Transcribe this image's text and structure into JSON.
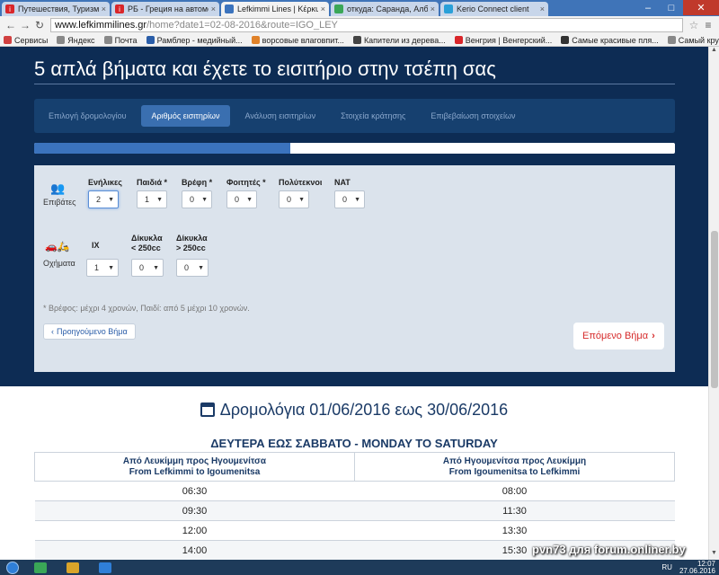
{
  "browser": {
    "tabs": [
      {
        "label": "Путешествия, Туризм и ...",
        "fav_color": "#d9262a",
        "fav_glyph": "i",
        "active": false
      },
      {
        "label": "РБ - Греция на автомоби...",
        "fav_color": "#d9262a",
        "fav_glyph": "i",
        "active": false
      },
      {
        "label": "Lefkimmi Lines | Κέρκυρα ...",
        "fav_color": "#3b73bd",
        "fav_glyph": "",
        "active": true
      },
      {
        "label": "откуда: Саранда, Албани...",
        "fav_color": "#3aa757",
        "fav_glyph": "",
        "active": false
      },
      {
        "label": "Kerio Connect client",
        "fav_color": "#2aa0d8",
        "fav_glyph": "",
        "active": false
      }
    ],
    "url_host": "www.lefkimmilines.gr",
    "url_path": "/home?date1=02-08-2016&route=IGO_LEY",
    "bookmarks": [
      {
        "label": "Сервисы",
        "color": "#d04040"
      },
      {
        "label": "Яндекс",
        "color": "#888888"
      },
      {
        "label": "Почта",
        "color": "#888888"
      },
      {
        "label": "Рамблер - медийный...",
        "color": "#2a5da8"
      },
      {
        "label": "ворсовые влаговпит...",
        "color": "#e0822a"
      },
      {
        "label": "Капители из дерева...",
        "color": "#444444"
      },
      {
        "label": "Венгрия | Венгерский...",
        "color": "#d9262a"
      },
      {
        "label": "Самые красивые пля...",
        "color": "#333333"
      },
      {
        "label": "Самый крупный торг...",
        "color": "#888888"
      }
    ],
    "bookmarks_more": "»"
  },
  "hero": {
    "title": "5 απλά βήματα και έχετε το εισιτήριο στην τσέπη σας",
    "steps": [
      {
        "label": "Επιλογή δρομολογίου",
        "active": false
      },
      {
        "label": "Αριθμός εισιτηρίων",
        "active": true
      },
      {
        "label": "Ανάλυση εισιτηρίων",
        "active": false
      },
      {
        "label": "Στοιχεία κράτησης",
        "active": false
      },
      {
        "label": "Επιβεβαίωση στοιχείων",
        "active": false
      }
    ],
    "progress_fraction": 0.4
  },
  "form": {
    "passengers_label": "Επιβάτες",
    "passengers": [
      {
        "label": "Ενήλικες",
        "value": "2"
      },
      {
        "label": "Παιδιά *",
        "value": "1"
      },
      {
        "label": "Βρέφη *",
        "value": "0"
      },
      {
        "label": "Φοιτητές *",
        "value": "0"
      },
      {
        "label": "Πολύτεκνοι",
        "value": "0"
      },
      {
        "label": "ΝΑΤ",
        "value": "0"
      }
    ],
    "vehicles_label": "Οχήματα",
    "vehicles": [
      {
        "label": "ΙΧ",
        "value": "1"
      },
      {
        "label": "Δίκυκλα\n< 250cc",
        "value": "0"
      },
      {
        "label": "Δίκυκλα\n> 250cc",
        "value": "0"
      }
    ],
    "note": "* Βρέφος: μέχρι 4 χρονών, Παιδί: από 5 μέχρι 10 χρονών.",
    "prev_button": "Προηγούμενο Βήμα",
    "next_button": "Επόμενο Βήμα"
  },
  "schedule": {
    "title": "Δρομολόγια 01/06/2016 εως 30/06/2016",
    "subtitle": "ΔΕΥΤΕΡΑ ΕΩΣ ΣΑΒΒΑΤΟ - MONDAY TO SATURDAY",
    "headers": [
      [
        "Από Λευκίμμη προς Ηγουμενίτσα",
        "From Lefkimmi to Igoumenitsa"
      ],
      [
        "Από Ηγουμενίτσα προς Λευκίμμη",
        "From Igoumenitsa to Lefkimmi"
      ]
    ],
    "rows": [
      [
        "06:30",
        "08:00"
      ],
      [
        "09:30",
        "11:30"
      ],
      [
        "12:00",
        "13:30"
      ],
      [
        "14:00",
        "15:30"
      ]
    ]
  },
  "taskbar": {
    "lang": "RU",
    "time": "12:07",
    "date": "27.06.2016",
    "apps": [
      "#3aa757",
      "#d9a42a",
      "#2f7fd8"
    ]
  },
  "watermark": "pvn73 для forum.onliner.by"
}
